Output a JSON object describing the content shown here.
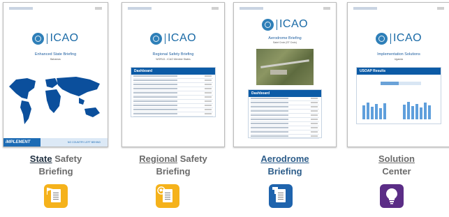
{
  "cards": [
    {
      "logo": "ICAO",
      "title": "Enhanced State Briefing",
      "subtitle": "Bahamas",
      "footer_brand": "iMPLEMENT",
      "footer_tagline": "NO COUNTRY LEFT BEHIND"
    },
    {
      "logo": "ICAO",
      "title": "Regional Safety Briefing",
      "subtitle": "WORLD - ICAO Member States",
      "dashboard": "Dashboard"
    },
    {
      "logo": "ICAO",
      "title": "Aerodrome Briefing",
      "subtitle": "Saint Croix (ST Croix)",
      "dashboard": "Dashboard"
    },
    {
      "logo": "ICAO",
      "title": "Implementation Solutions",
      "subtitle": "Uganda",
      "results": "USOAP Results"
    }
  ],
  "labels": [
    {
      "underlined": "State",
      "rest": " Safety",
      "line2": "Briefing",
      "color": "#6b6b6b"
    },
    {
      "underlined": "Regional",
      "rest": " Safety",
      "line2": "Briefing",
      "color": "#6b6b6b"
    },
    {
      "underlined": "Aerodrome",
      "rest": "",
      "line2": "Briefing",
      "color": "#2d5d8a"
    },
    {
      "underlined": "Solution",
      "rest": "",
      "line2": "Center",
      "color": "#6b6b6b"
    }
  ],
  "icons": [
    {
      "name": "state-briefing-icon",
      "color": "#f5b21b"
    },
    {
      "name": "regional-briefing-icon",
      "color": "#f5b21b"
    },
    {
      "name": "aerodrome-briefing-icon",
      "color": "#1f64ad"
    },
    {
      "name": "solution-center-icon",
      "color": "#5b2d86"
    }
  ]
}
